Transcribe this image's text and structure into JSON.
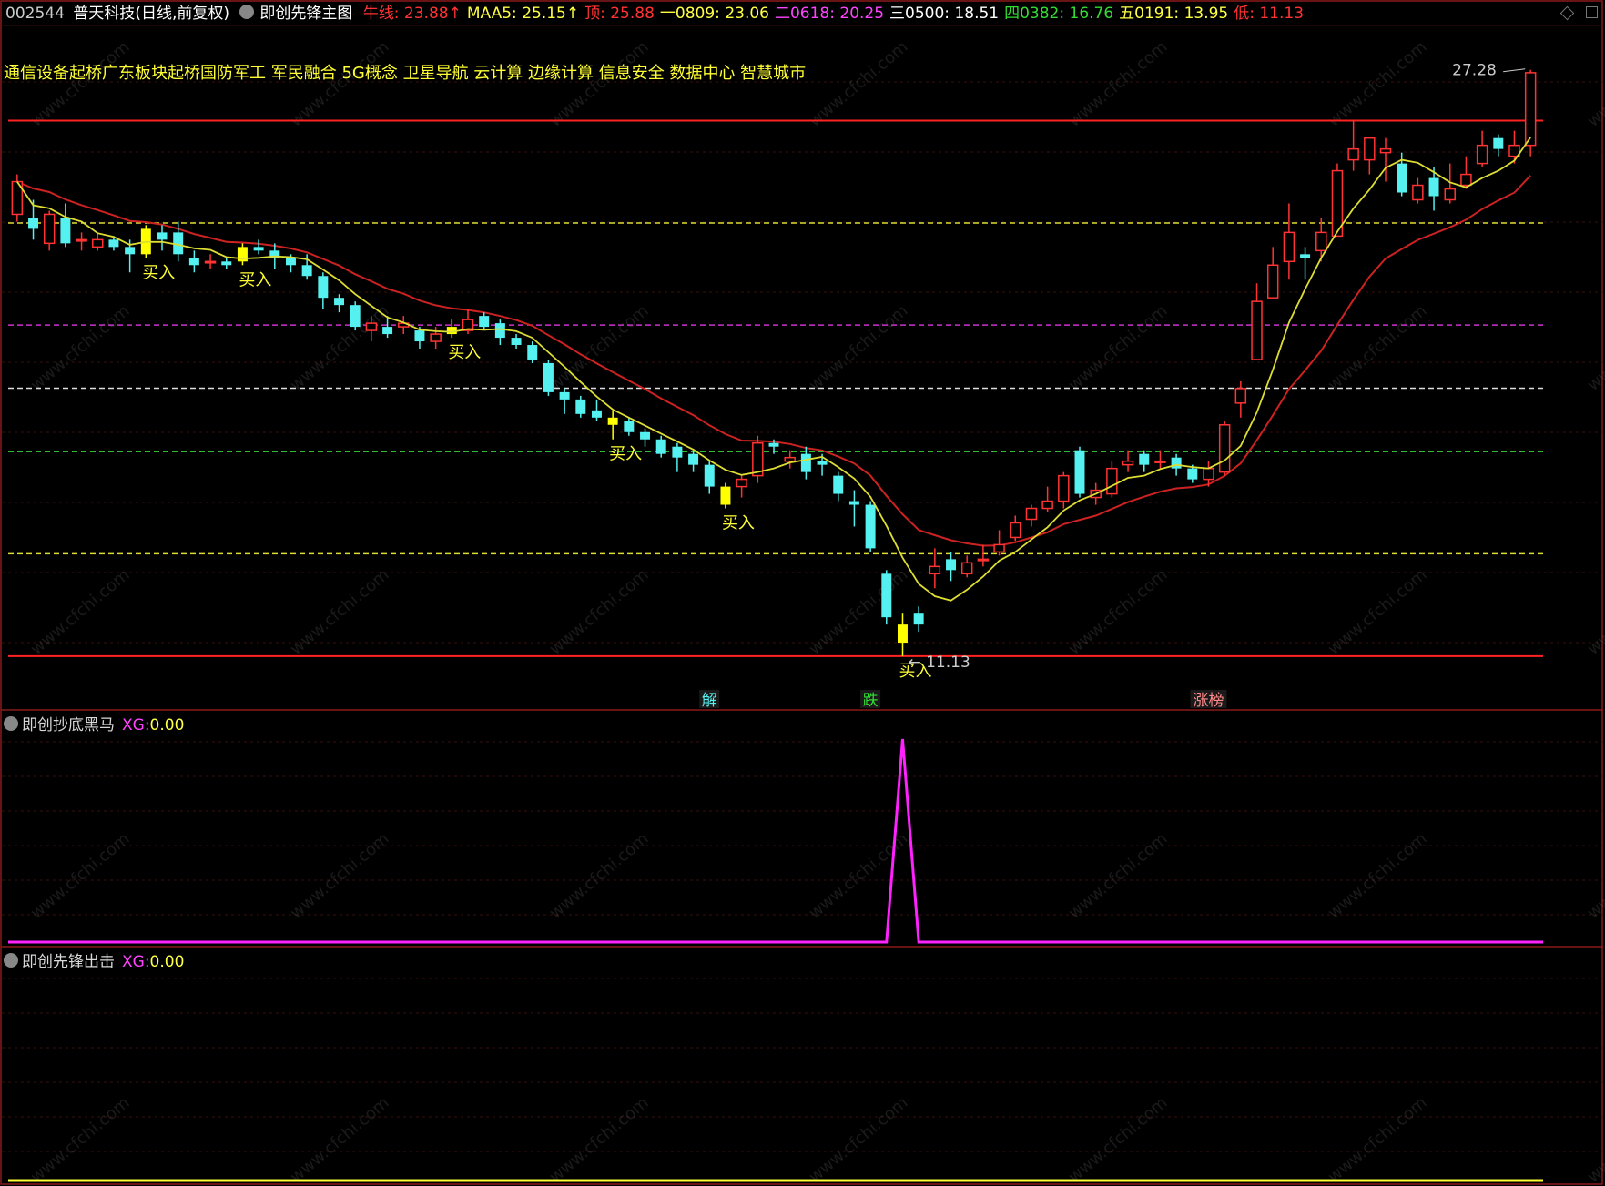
{
  "header": {
    "code": "002544",
    "name": "普天科技",
    "period": "(日线,前复权)",
    "main_indicator": "即创先锋主图",
    "items": [
      {
        "label": "牛线:",
        "value": "23.88↑",
        "color": "#ff3333"
      },
      {
        "label": "MAA5:",
        "value": "25.15↑",
        "color": "#ffff44"
      },
      {
        "label": "顶:",
        "value": "25.88",
        "color": "#ff3333"
      },
      {
        "label": "一0809:",
        "value": "23.06",
        "color": "#ffff44"
      },
      {
        "label": "二0618:",
        "value": "20.25",
        "color": "#ff44ff"
      },
      {
        "label": "三0500:",
        "value": "18.51",
        "color": "#ffffff"
      },
      {
        "label": "四0382:",
        "value": "16.76",
        "color": "#33dd33"
      },
      {
        "label": "五0191:",
        "value": "13.95",
        "color": "#ffff44"
      },
      {
        "label": "低:",
        "value": "11.13",
        "color": "#ff3333"
      }
    ]
  },
  "concepts": "通信设备起桥广东板块起桥国防军工 军民融合 5G概念 卫星导航 云计算 边缘计算 信息安全 数据中心 智慧城市",
  "watermark": "www.cfchi.com",
  "colors": {
    "up": "#ff3333",
    "down": "#55f0f0",
    "buy": "#ffff00",
    "ma_fast": "#dddd33",
    "ma_slow": "#cc2222",
    "xg_line": "#ff22ff",
    "grid": "#3a1010"
  },
  "chart_data": [
    {
      "type": "candlestick",
      "title": "即创先锋主图",
      "ylim": [
        10.6,
        28.2
      ],
      "price_labels": {
        "high": "27.28",
        "low": "11.13"
      },
      "levels": [
        {
          "name": "顶",
          "value": 25.88,
          "color": "#ff2222",
          "style": "solid"
        },
        {
          "name": "一0809",
          "value": 23.06,
          "color": "#dddd33",
          "style": "dashed"
        },
        {
          "name": "二0618",
          "value": 20.25,
          "color": "#cc33cc",
          "style": "dashed"
        },
        {
          "name": "三0500",
          "value": 18.51,
          "color": "#dddddd",
          "style": "dashed"
        },
        {
          "name": "四0382",
          "value": 16.76,
          "color": "#33bb33",
          "style": "dashed"
        },
        {
          "name": "五0191",
          "value": 13.95,
          "color": "#dddd33",
          "style": "dashed"
        },
        {
          "name": "低",
          "value": 11.13,
          "color": "#ff2222",
          "style": "solid"
        }
      ],
      "candles": [
        [
          23.3,
          24.2,
          24.4,
          23.1
        ],
        [
          23.2,
          22.9,
          23.7,
          22.6
        ],
        [
          22.5,
          23.3,
          23.4,
          22.3
        ],
        [
          23.2,
          22.5,
          23.6,
          22.4
        ],
        [
          22.6,
          22.6,
          22.8,
          22.3
        ],
        [
          22.4,
          22.6,
          22.8,
          22.3
        ],
        [
          22.6,
          22.4,
          22.7,
          22.3
        ],
        [
          22.4,
          22.2,
          22.6,
          21.7
        ],
        [
          22.2,
          22.9,
          23.0,
          22.1
        ],
        [
          22.8,
          22.6,
          23.0,
          22.3
        ],
        [
          22.8,
          22.2,
          23.1,
          22.0
        ],
        [
          22.1,
          21.9,
          22.3,
          21.7
        ],
        [
          22.0,
          22.0,
          22.2,
          21.8
        ],
        [
          22.0,
          21.9,
          22.1,
          21.8
        ],
        [
          22.0,
          22.4,
          22.5,
          21.9
        ],
        [
          22.4,
          22.3,
          22.6,
          22.2
        ],
        [
          22.3,
          22.1,
          22.5,
          21.8
        ],
        [
          22.1,
          21.9,
          22.2,
          21.7
        ],
        [
          21.9,
          21.6,
          22.2,
          21.5
        ],
        [
          21.6,
          21.0,
          21.7,
          20.7
        ],
        [
          21.0,
          20.8,
          21.1,
          20.6
        ],
        [
          20.8,
          20.2,
          20.9,
          20.1
        ],
        [
          20.1,
          20.3,
          20.5,
          19.8
        ],
        [
          20.2,
          20.0,
          20.5,
          19.9
        ],
        [
          20.2,
          20.3,
          20.5,
          20.0
        ],
        [
          20.1,
          19.8,
          20.2,
          19.6
        ],
        [
          19.8,
          20.0,
          20.2,
          19.6
        ],
        [
          20.0,
          20.2,
          20.4,
          19.9
        ],
        [
          20.1,
          20.4,
          20.7,
          20.0
        ],
        [
          20.5,
          20.2,
          20.6,
          20.1
        ],
        [
          20.3,
          19.9,
          20.4,
          19.7
        ],
        [
          19.9,
          19.7,
          20.0,
          19.6
        ],
        [
          19.7,
          19.3,
          19.8,
          19.2
        ],
        [
          19.2,
          18.4,
          19.3,
          18.3
        ],
        [
          18.4,
          18.2,
          18.5,
          17.8
        ],
        [
          18.2,
          17.8,
          18.3,
          17.7
        ],
        [
          17.9,
          17.7,
          18.2,
          17.6
        ],
        [
          17.7,
          17.5,
          17.9,
          17.1
        ],
        [
          17.6,
          17.3,
          17.7,
          17.2
        ],
        [
          17.3,
          17.1,
          17.4,
          16.9
        ],
        [
          17.1,
          16.7,
          17.2,
          16.6
        ],
        [
          16.9,
          16.6,
          17.0,
          16.2
        ],
        [
          16.7,
          16.4,
          16.8,
          16.2
        ],
        [
          16.4,
          15.8,
          16.5,
          15.6
        ],
        [
          15.3,
          15.8,
          15.9,
          15.2
        ],
        [
          15.8,
          16.0,
          16.1,
          15.5
        ],
        [
          16.1,
          17.0,
          17.2,
          15.9
        ],
        [
          17.0,
          16.9,
          17.1,
          16.7
        ],
        [
          16.5,
          16.6,
          16.8,
          16.3
        ],
        [
          16.7,
          16.2,
          16.9,
          16.0
        ],
        [
          16.5,
          16.4,
          16.7,
          16.1
        ],
        [
          16.1,
          15.6,
          16.2,
          15.4
        ],
        [
          15.4,
          15.3,
          15.7,
          14.7
        ],
        [
          15.3,
          14.1,
          15.4,
          14.0
        ],
        [
          13.4,
          12.2,
          13.5,
          12.0
        ],
        [
          11.5,
          12.0,
          12.3,
          11.13
        ],
        [
          12.3,
          12.0,
          12.5,
          11.8
        ],
        [
          13.4,
          13.6,
          14.1,
          13.0
        ],
        [
          13.8,
          13.5,
          14.0,
          13.2
        ],
        [
          13.4,
          13.7,
          13.9,
          13.3
        ],
        [
          13.8,
          13.8,
          14.2,
          13.6
        ],
        [
          14.0,
          14.2,
          14.6,
          13.9
        ],
        [
          14.4,
          14.8,
          15.0,
          14.3
        ],
        [
          14.9,
          15.2,
          15.3,
          14.7
        ],
        [
          15.2,
          15.4,
          15.8,
          15.1
        ],
        [
          15.4,
          16.1,
          16.2,
          15.2
        ],
        [
          16.8,
          15.6,
          16.9,
          15.5
        ],
        [
          15.5,
          15.7,
          15.9,
          15.3
        ],
        [
          15.6,
          16.3,
          16.5,
          15.5
        ],
        [
          16.4,
          16.5,
          16.8,
          16.2
        ],
        [
          16.7,
          16.4,
          16.8,
          16.2
        ],
        [
          16.5,
          16.5,
          16.8,
          16.3
        ],
        [
          16.6,
          16.3,
          16.7,
          16.1
        ],
        [
          16.3,
          16.0,
          16.4,
          15.9
        ],
        [
          16.0,
          16.3,
          16.5,
          15.8
        ],
        [
          16.2,
          17.5,
          17.6,
          16.1
        ],
        [
          18.1,
          18.5,
          18.7,
          17.7
        ],
        [
          19.3,
          20.9,
          21.4,
          19.3
        ],
        [
          21.0,
          21.9,
          22.4,
          21.0
        ],
        [
          22.0,
          22.8,
          23.6,
          21.5
        ],
        [
          22.2,
          22.1,
          22.4,
          21.5
        ],
        [
          22.3,
          22.8,
          23.2,
          22.0
        ],
        [
          22.7,
          24.5,
          24.7,
          22.7
        ],
        [
          24.8,
          25.1,
          25.9,
          24.5
        ],
        [
          24.8,
          25.4,
          25.3,
          24.4
        ],
        [
          25.0,
          25.1,
          25.4,
          24.2
        ],
        [
          24.7,
          23.9,
          25.0,
          23.8
        ],
        [
          23.7,
          24.1,
          24.3,
          23.6
        ],
        [
          24.3,
          23.8,
          24.6,
          23.4
        ],
        [
          23.7,
          24.0,
          24.7,
          23.6
        ],
        [
          24.1,
          24.4,
          24.9,
          24.0
        ],
        [
          24.7,
          25.2,
          25.6,
          24.6
        ],
        [
          25.4,
          25.1,
          25.5,
          24.9
        ],
        [
          24.9,
          25.2,
          25.6,
          24.7
        ],
        [
          25.2,
          27.2,
          27.28,
          24.9
        ]
      ],
      "buy_signals": [
        8,
        14,
        27,
        37,
        44,
        55
      ],
      "buy_label": "买入",
      "event_labels": [
        {
          "index": 43,
          "text": "解",
          "color": "#55f0f0"
        },
        {
          "index": 53,
          "text": "跌",
          "color": "#33dd33"
        },
        {
          "index": 74,
          "text": "涨榜",
          "color": "#ff8888"
        }
      ]
    },
    {
      "type": "line",
      "title": "即创抄底黑马",
      "series": [
        {
          "name": "XG",
          "value_label": "0.00",
          "spike_index": 55,
          "spike_value": 1
        }
      ],
      "ylim": [
        0,
        1
      ]
    },
    {
      "type": "line",
      "title": "即创先锋出击",
      "series": [
        {
          "name": "XG",
          "value_label": "0.00"
        }
      ]
    }
  ],
  "panels": {
    "sub1": {
      "name": "即创抄底黑马",
      "ind": "XG:",
      "val": "0.00"
    },
    "sub2": {
      "name": "即创先锋出击",
      "ind": "XG:",
      "val": "0.00"
    }
  }
}
